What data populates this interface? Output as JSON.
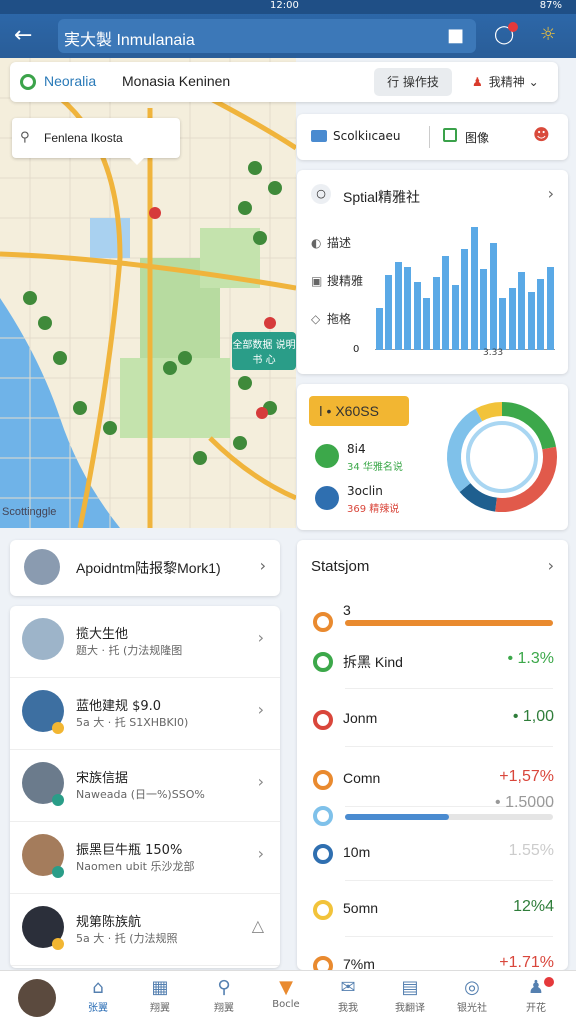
{
  "status_bar": {
    "time": "12:00",
    "battery": "87%"
  },
  "app_bar": {
    "search_text": "実大製 Inmulanaia",
    "back_icon": "arrow-left-icon",
    "gift_icon": "gift-icon",
    "chat_icon": "chat-icon",
    "sun_icon": "sun-icon"
  },
  "location_bar": {
    "name_colored": "Neoralia",
    "name": "Monasia Keninen",
    "button1": "行 操作技",
    "button2": "我精神"
  },
  "map": {
    "bubble_text": "Fenlena Ikosta",
    "tag_text": "全部数据 说明书 心",
    "credit": "Scottinggle"
  },
  "toolbar": {
    "item1": "Scolkiıcaeu",
    "item2": "图像"
  },
  "stats_card": {
    "title": "Sptial精雅社",
    "rows": [
      {
        "label": "描述"
      },
      {
        "label": "搜精雅"
      },
      {
        "label": "拖格"
      }
    ],
    "zero_label": "0",
    "x_label": "3.33",
    "chart_data": {
      "type": "bar",
      "values": [
        32,
        58,
        68,
        64,
        52,
        40,
        56,
        72,
        50,
        78,
        95,
        62,
        82,
        40,
        48,
        60,
        45,
        55,
        64
      ],
      "ylim": [
        0,
        100
      ]
    }
  },
  "donut_card": {
    "pill": "ǀ • X60SS",
    "legend": [
      {
        "a": "8i4",
        "b": "34 华雅名说",
        "color": "#3ca84a"
      },
      {
        "a": "3oclin",
        "b": "369 精辣说",
        "color": "#2f6fb0"
      }
    ],
    "chart_data": {
      "type": "pie",
      "values": [
        22,
        30,
        12,
        28,
        8
      ],
      "colors": [
        "#3ca84a",
        "#e15a4b",
        "#1f5f8f",
        "#7fc1ea",
        "#f2c33a"
      ]
    }
  },
  "appointment": {
    "text": "Apoidntm陆报黎Mork1)"
  },
  "people": [
    {
      "name": "揽大生他",
      "sub": "题大 · 托 (力法规隆图"
    },
    {
      "name": "蓝他建规 $9.0",
      "sub": "5a 大 · 托 S1XHBKI0)"
    },
    {
      "name": "宋族信据",
      "sub": "Naweada (日一%)SSO%"
    },
    {
      "name": "振黑巨牛瓶 150%",
      "sub": "Naomen ubit 乐沙龙部"
    },
    {
      "name": "规第陈族航",
      "sub": "5a 大 · 托 (力法规照"
    }
  ],
  "statlist": {
    "title": "Statsjom",
    "rows": [
      {
        "label": "3",
        "value": "",
        "bar": 1.0,
        "bar_color": "#e98a2f",
        "icon_color": "#e98a2f"
      },
      {
        "label": "拆黑 Kind",
        "value": "• 1.3%",
        "value_color": "#3ca84a",
        "icon_color": "#3ca84a"
      },
      {
        "label": "Jonm",
        "value": "• 1,00",
        "value_color": "#2f7d3a",
        "icon_color": "#d9463b"
      },
      {
        "label": "Comn",
        "value": "+1,57%",
        "value_color": "#d9463b",
        "icon_color": "#e98a2f"
      },
      {
        "label": "",
        "value": "• 1.5000",
        "value_color": "#999",
        "bar": 0.5,
        "bar_color": "#4a8bd0",
        "icon_color": "#7fc1ea"
      },
      {
        "label": "10m",
        "value": "1.55%",
        "value_color": "#ccc",
        "icon_color": "#2f6fb0"
      },
      {
        "label": "5omn",
        "value": "12%4",
        "value_color": "#2f7d3a",
        "icon_color": "#f2c33a"
      },
      {
        "label": "7%m",
        "value": "+1.71%",
        "value_color": "#d9463b",
        "icon_color": "#e98a2f"
      }
    ]
  },
  "bottom_nav": [
    {
      "label": "张翼",
      "icon": "home-icon"
    },
    {
      "label": "翔翼",
      "icon": "grid-icon"
    },
    {
      "label": "翔翼",
      "icon": "search-icon"
    },
    {
      "label": "Bocle",
      "icon": "shield-icon"
    },
    {
      "label": "我我",
      "icon": "mail-icon"
    },
    {
      "label": "我翻译",
      "icon": "doc-icon"
    },
    {
      "label": "银光社",
      "icon": "globe-icon"
    },
    {
      "label": "开花",
      "icon": "profile-icon"
    }
  ]
}
